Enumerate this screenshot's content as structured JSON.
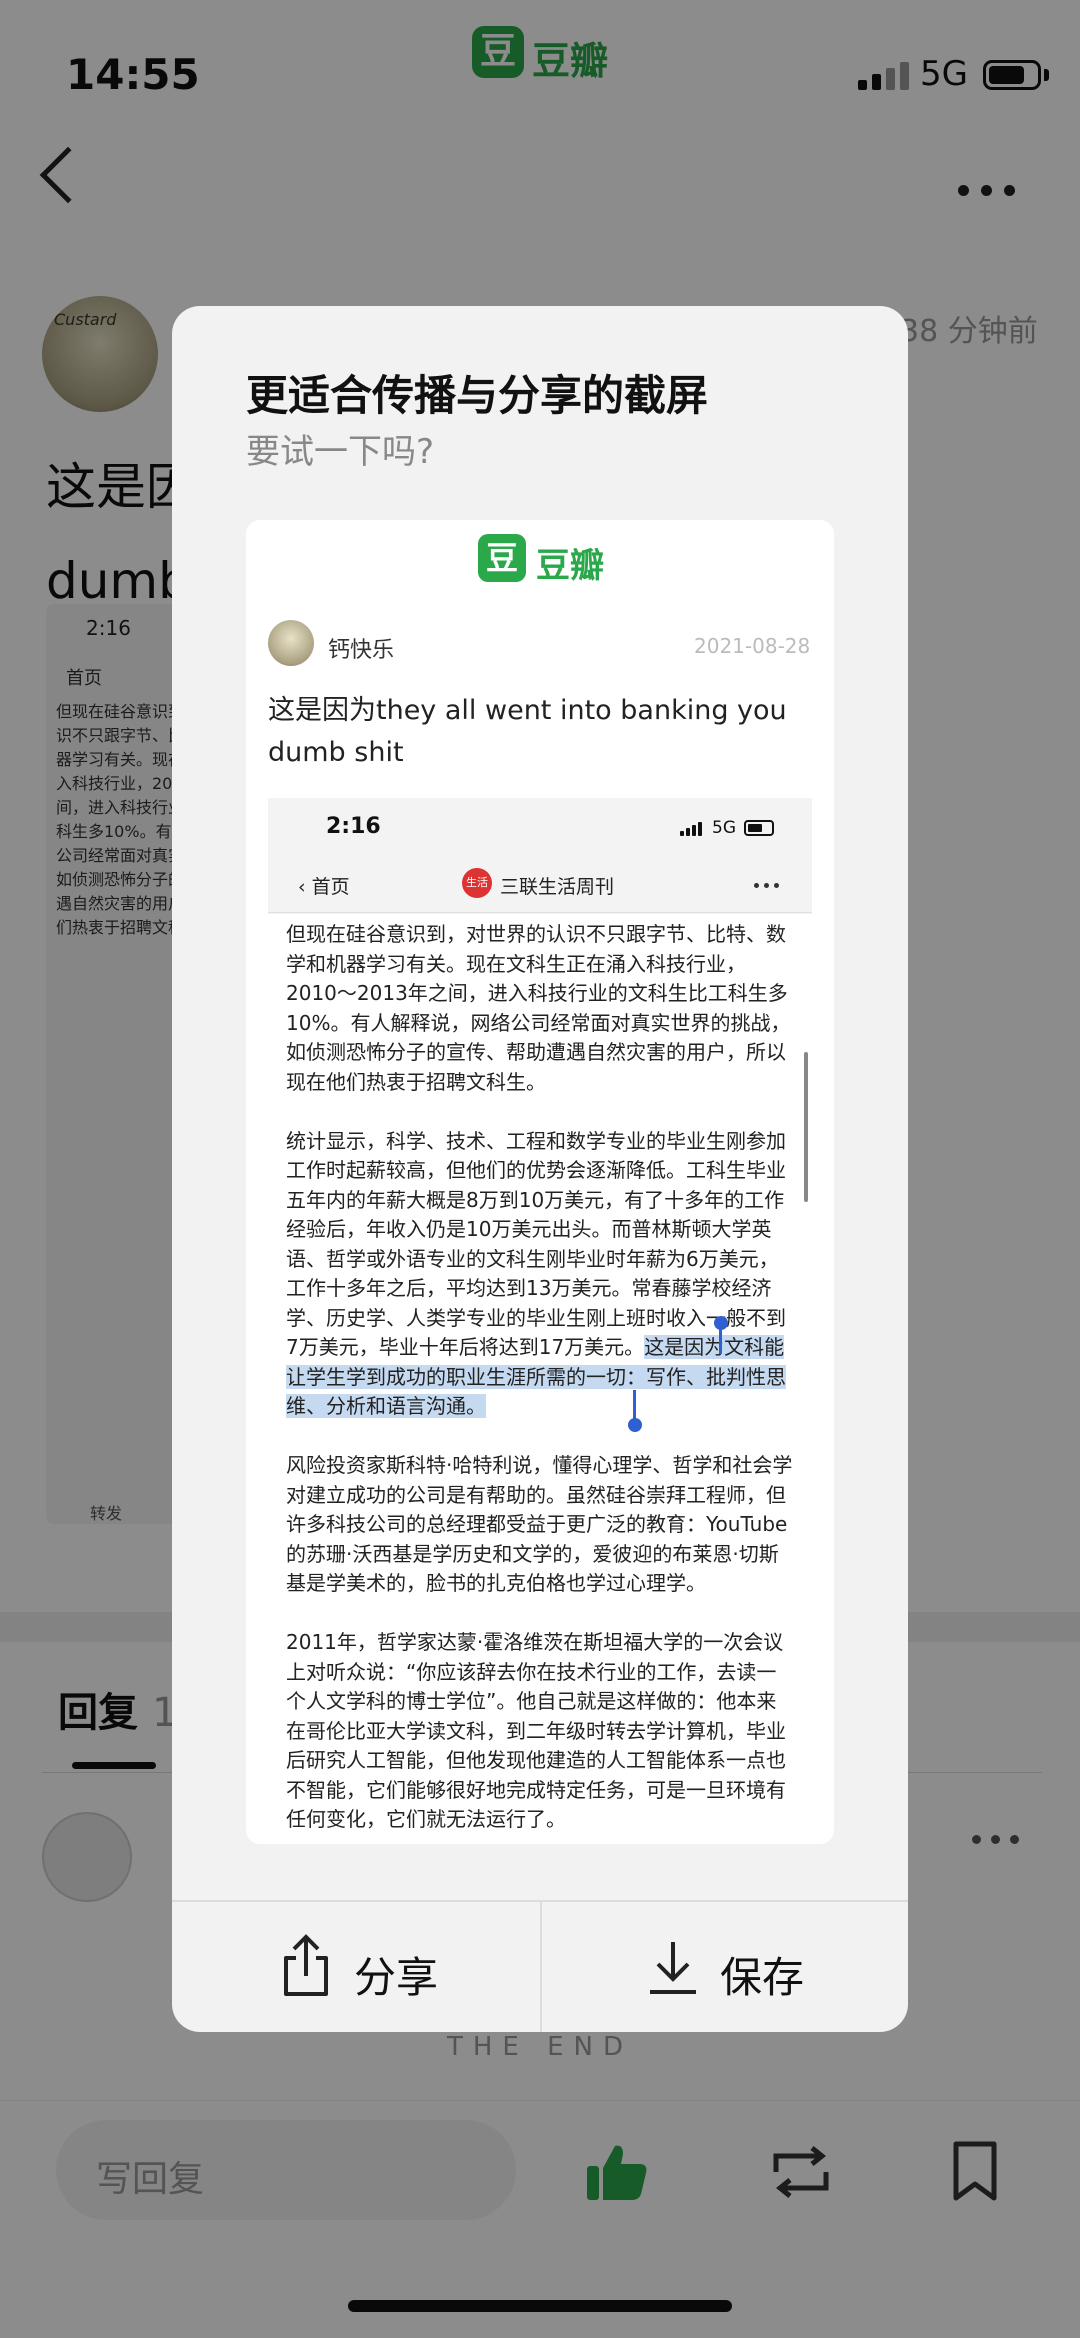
{
  "status_bar": {
    "time": "14:55",
    "network": "5G"
  },
  "app": {
    "logo_char": "豆",
    "logo_text": "豆瓣",
    "brand_color": "#2aa84a"
  },
  "post": {
    "time_ago": "38 分钟前",
    "title_partial": "这是因",
    "title_line2_partial": "dumb",
    "repost_label": "转发"
  },
  "replies": {
    "tab_label": "回复",
    "tab_count": "1",
    "end_text": "THE END"
  },
  "bottom_bar": {
    "reply_placeholder": "写回复"
  },
  "modal": {
    "title": "更适合传播与分享的截屏",
    "subtitle": "要试一下吗?",
    "card": {
      "logo_char": "豆",
      "logo_text": "豆瓣",
      "author": "钙快乐",
      "date": "2021-08-28",
      "text": "这是因为they all went into banking you dumb shit",
      "screenshot": {
        "time": "2:16",
        "network": "5G",
        "back_label": "首页",
        "source_icon": "生活",
        "source": "三联生活周刊",
        "paragraphs": [
          "但现在硅谷意识到，对世界的认识不只跟字节、比特、数学和机器学习有关。现在文科生正在涌入科技行业，2010～2013年之间，进入科技行业的文科生比工科生多10%。有人解释说，网络公司经常面对真实世界的挑战，如侦测恐怖分子的宣传、帮助遭遇自然灾害的用户，所以现在他们热衷于招聘文科生。",
          "风险投资家斯科特·哈特利说，懂得心理学、哲学和社会学对建立成功的公司是有帮助的。虽然硅谷崇拜工程师，但许多科技公司的总经理都受益于更广泛的教育：YouTube的苏珊·沃西基是学历史和文学的，爱彼迎的布莱恩·切斯基是学美术的，脸书的扎克伯格也学过心理学。",
          "2011年，哲学家达蒙·霍洛维茨在斯坦福大学的一次会议上对听众说：“你应该辞去你在技术行业的工作，去读一个人文学科的博士学位”。他自己就是这样做的：他本来在哥伦比亚大学读文科，到二年级时转去学计算机，毕业后研究人工智能，但他发现他建造的人工智能体系一点也不智能，它们能够很好地完成特定任务，可是一旦环境有任何变化，它们就无法运行了。"
        ],
        "stats_paragraph_plain": "统计显示，科学、技术、工程和数学专业的毕业生刚参加工作时起薪较高，但他们的优势会逐渐降低。工科生毕业五年内的年薪大概是8万到10万美元，有了十多年的工作经验后，年收入仍是10万美元出头。而普林斯顿大学英语、哲学或外语专业的文科生刚毕业时年薪为6万美元，工作十多年之后，平均达到13万美元。常春藤学校经济学、历史学、人类学专业的毕业生刚上班时收入一般不到7万美元，毕业十年后将达到17万美元。",
        "stats_paragraph_highlight": "这是因为文科能让学生学到成功的职业生涯所需的一切：写作、批判性思维、分析和语言沟通。"
      }
    },
    "share_label": "分享",
    "save_label": "保存"
  }
}
